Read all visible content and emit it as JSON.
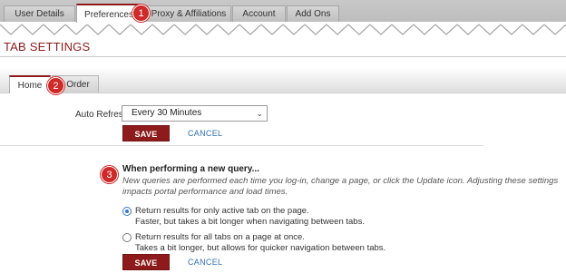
{
  "top_tabs": [
    {
      "label": "User Details"
    },
    {
      "label": "Preferences"
    },
    {
      "label": "Proxy & Affiliations"
    },
    {
      "label": "Account"
    },
    {
      "label": "Add Ons"
    }
  ],
  "page_title": "TAB SETTINGS",
  "sub_tabs": [
    {
      "label": "Home"
    },
    {
      "label": "Order"
    }
  ],
  "badges": [
    "1",
    "2",
    "3"
  ],
  "auto_refresh": {
    "label": "Auto Refresh",
    "selected": "Every 30 Minutes",
    "save_label": "SAVE",
    "cancel_label": "CANCEL"
  },
  "query_section": {
    "title": "When performing a new query...",
    "description": "New queries are performed each time you log-in, change a page, or click the Update icon. Adjusting these settings impacts portal performance and load times.",
    "options": [
      {
        "line1": "Return results for only active tab on the page.",
        "line2": "Faster, but takes a bit longer when navigating between tabs.",
        "checked": true
      },
      {
        "line1": "Return results for all tabs on a page at once.",
        "line2": "Takes a bit longer, but allows for quicker navigation between tabs.",
        "checked": false
      }
    ],
    "save_label": "SAVE",
    "cancel_label": "CANCEL"
  },
  "colors": {
    "accent": "#8e1b1b",
    "badge": "#cf2a2a",
    "link": "#2e6fb5"
  }
}
